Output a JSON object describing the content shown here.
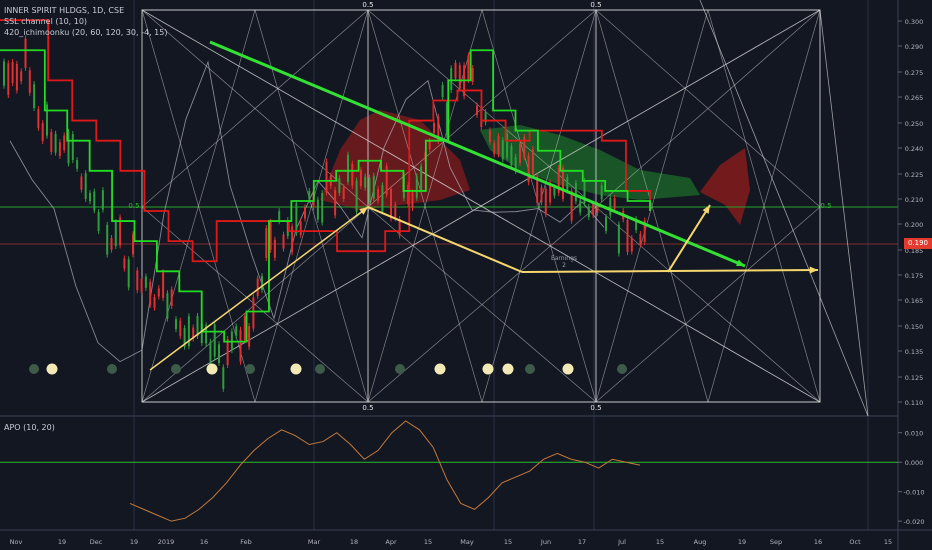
{
  "header": {
    "symbol_line": "INNER SPIRIT HLDGS, 1D, CSE",
    "indicator_1": "SSL channel (10, 10)",
    "indicator_2": "420_ichimoonku (20, 60, 120, 30, -4, 15)"
  },
  "oscillator": {
    "title": "APO (10, 20)"
  },
  "current_price_label": "0.190",
  "colors": {
    "background": "#131722",
    "candle_up": "#2e9e3e",
    "candle_down": "#e03030",
    "ssl_green": "#22dd22",
    "ssl_red": "#e01818",
    "cloud_green": "#1e6b2a",
    "cloud_red": "#8c1c1c",
    "trend_green": "#33e033",
    "trend_yellow": "#f5d76e",
    "apo_line": "#c27a3a",
    "apo_zero": "#2db82d",
    "gann_lines": "#d8d8d8"
  },
  "chart_data": [
    {
      "type": "line",
      "title": "INNER SPIRIT HLDGS, 1D, CSE",
      "y_axis": {
        "ylim": [
          0.103,
          0.31
        ],
        "ticks": [
          0.3,
          0.29,
          0.28,
          0.275,
          0.265,
          0.25,
          0.24,
          0.225,
          0.21,
          0.2,
          0.185,
          0.175,
          0.165,
          0.15,
          0.14,
          0.125,
          0.11
        ],
        "tick_labels": [
          "0.300",
          "0.290",
          "0.275",
          "0.275",
          "0.265",
          "0.250",
          "0.240",
          "0.225",
          "0.210",
          "0.200",
          "0.185",
          "0.175",
          "0.165",
          "0.150",
          "0.135",
          "0.125",
          "0.110"
        ],
        "side": "right"
      },
      "x_axis": {
        "tick_labels": [
          "Nov",
          "19",
          "Dec",
          "19",
          "2019",
          "16",
          "Feb",
          "Mar",
          "18",
          "Apr",
          "15",
          "May",
          "15",
          "Jun",
          "17",
          "Jul",
          "15",
          "Aug",
          "19",
          "Sep",
          "16",
          "Oct",
          "15"
        ]
      },
      "annotations": {
        "gann_level_labels": [
          "0.5",
          "0.5",
          "0.5",
          "0.5",
          "0.5",
          "0.5"
        ],
        "earnings_label": [
          "Earnings",
          "2"
        ]
      },
      "series": [
        {
          "name": "SSL channel (10, 10)",
          "values_green": [
            0.285,
            0.285,
            0.255,
            0.24,
            0.225,
            0.2,
            0.19,
            0.175,
            0.165,
            0.145,
            0.14,
            0.155,
            0.2,
            0.21,
            0.22,
            0.225,
            0.23,
            0.225,
            0.215,
            0.24,
            0.27,
            0.285,
            0.255,
            0.245,
            0.235,
            0.225,
            0.22,
            0.215,
            0.21,
            0.205
          ],
          "values_red": [
            0.3,
            0.3,
            0.27,
            0.25,
            0.24,
            0.225,
            0.205,
            0.19,
            0.18,
            0.2,
            0.2,
            0.2,
            0.195,
            0.195,
            0.185,
            0.185,
            0.195,
            0.25,
            0.26,
            0.265,
            0.25,
            0.24,
            0.245,
            0.245,
            0.245,
            0.24,
            0.215,
            0.205
          ]
        }
      ]
    },
    {
      "type": "line",
      "title": "APO (10, 20)",
      "y_axis": {
        "ylim": [
          -0.023,
          0.015
        ],
        "ticks": [
          0.01,
          0.0,
          -0.01,
          -0.02
        ],
        "tick_labels": [
          "0.010",
          "0.000",
          "-0.010",
          "-0.020"
        ],
        "side": "right"
      },
      "series": [
        {
          "name": "APO (10, 20)",
          "values": [
            -0.014,
            -0.016,
            -0.018,
            -0.02,
            -0.019,
            -0.016,
            -0.012,
            -0.007,
            -0.001,
            0.004,
            0.008,
            0.011,
            0.009,
            0.006,
            0.007,
            0.01,
            0.006,
            0.001,
            0.004,
            0.01,
            0.014,
            0.011,
            0.005,
            -0.006,
            -0.014,
            -0.016,
            -0.012,
            -0.007,
            -0.005,
            -0.003,
            0.001,
            0.003,
            0.001,
            0.0,
            -0.002,
            0.001,
            0.0,
            -0.001
          ]
        }
      ]
    }
  ]
}
